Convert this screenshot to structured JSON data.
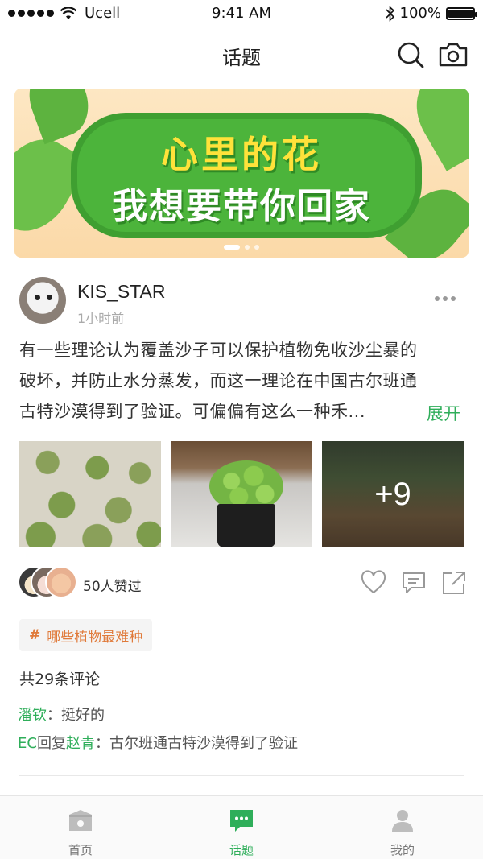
{
  "status_bar": {
    "carrier": "Ucell",
    "time": "9:41 AM",
    "battery": "100%"
  },
  "header": {
    "title": "话题"
  },
  "banner": {
    "line1": "心里的花",
    "line2": "我想要带你回家",
    "slide_count": 3,
    "active_slide": 1
  },
  "post": {
    "username": "KIS_STAR",
    "time_ago": "1小时前",
    "text": "有一些理论认为覆盖沙子可以保护植物免收沙尘暴的破坏，并防止水分蒸发，而这一理论在中国古尔班通古特沙漠得到了验证。可偏偏有这么一种禾...",
    "expand_label": "展开",
    "extra_photos": "+9",
    "likes_text": "50人赞过",
    "topic_tag": "哪些植物最难种",
    "topic_hash": "#",
    "comment_count": "共29条评论",
    "comments": [
      {
        "name": "潘钦",
        "text": "：挺好的"
      },
      {
        "name": "EC",
        "reply_word": "回复",
        "reply_to": "赵青",
        "text": "：古尔班通古特沙漠得到了验证"
      }
    ]
  },
  "tabbar": {
    "items": [
      {
        "label": "首页",
        "icon": "home-icon"
      },
      {
        "label": "话题",
        "icon": "chat-bubble-icon"
      },
      {
        "label": "我的",
        "icon": "person-icon"
      }
    ],
    "active": 1
  },
  "colors": {
    "accent": "#2fae5a",
    "tag": "#e07a3a"
  }
}
